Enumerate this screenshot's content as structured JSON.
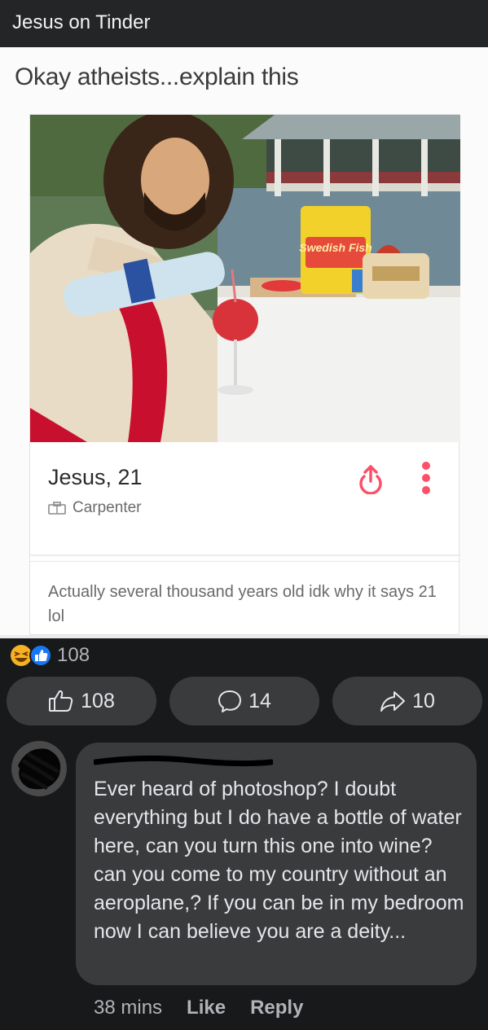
{
  "header": {
    "title": "Jesus on Tinder"
  },
  "post": {
    "caption": "Okay atheists...explain this",
    "profile": {
      "name": "Jesus, 21",
      "job": "Carpenter",
      "bio": "Actually several thousand years old idk why it says 21 lol",
      "candy_label": "Swedish Fish",
      "icons": [
        "share-icon",
        "more-dots-icon",
        "briefcase-icon"
      ]
    }
  },
  "reactions": {
    "count": "108",
    "icons": [
      "haha-icon",
      "like-icon"
    ]
  },
  "actions": {
    "like_count": "108",
    "comment_count": "14",
    "share_count": "10"
  },
  "comment": {
    "author": "",
    "text": "Ever heard of photoshop? I doubt everything but I do have a bottle of water here, can you turn this one into wine? can you  come to my country without an aeroplane,? If you can be in my bedroom now I can believe you are a deity...",
    "time": "38 mins",
    "like_label": "Like",
    "reply_label": "Reply"
  },
  "colors": {
    "background": "#18191a",
    "surface": "#242526",
    "button": "#3a3b3c",
    "like_blue": "#1877f2",
    "haha_yellow": "#f7b125",
    "tinder_orange": "#fd5068",
    "red_sash": "#c8102e"
  }
}
